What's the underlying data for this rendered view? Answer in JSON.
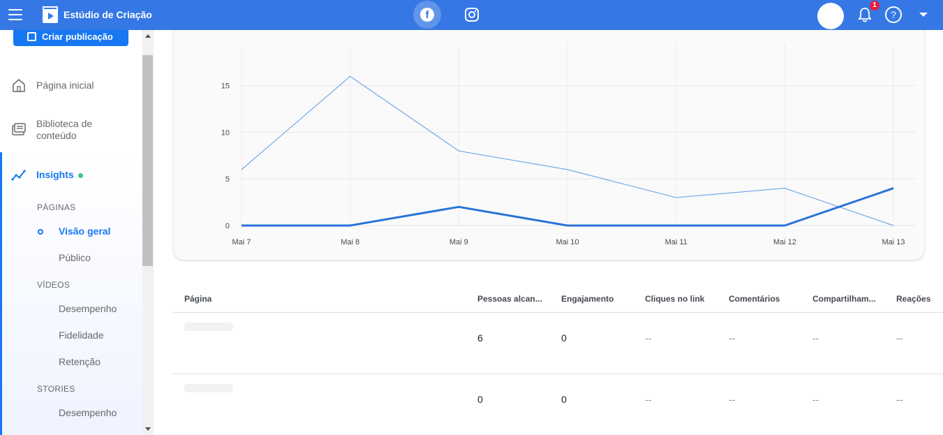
{
  "app": {
    "title": "Estúdio de Criação",
    "notification_count": "1",
    "help_label": "?",
    "facebook_glyph": "f"
  },
  "sidebar": {
    "create_label": "Criar publicação",
    "home_label": "Página inicial",
    "library_label": "Biblioteca de conteúdo",
    "insights_label": "Insights",
    "sections": {
      "pages": "PÁGINAS",
      "videos": "VÍDEOS",
      "stories": "STORIES"
    },
    "pages_items": [
      "Visão geral",
      "Público"
    ],
    "videos_items": [
      "Desempenho",
      "Fidelidade",
      "Retenção"
    ],
    "stories_items": [
      "Desempenho"
    ]
  },
  "chart_data": {
    "type": "line",
    "categories": [
      "Mai 7",
      "Mai 8",
      "Mai 9",
      "Mai 10",
      "Mai 11",
      "Mai 12",
      "Mai 13"
    ],
    "series": [
      {
        "values": [
          6,
          16,
          8,
          6,
          3,
          4,
          0
        ],
        "color": "#6fa8e8",
        "width": 1.2
      },
      {
        "values": [
          0,
          0,
          2,
          0,
          0,
          0,
          4
        ],
        "color": "#2a73d9",
        "width": 3
      }
    ],
    "yticks": [
      "0",
      "5",
      "10",
      "15"
    ],
    "ylim": [
      0,
      17
    ],
    "grid": true
  },
  "table": {
    "headers": [
      "Página",
      "Pessoas alcan...",
      "Engajamento",
      "Cliques no link",
      "Comentários",
      "Compartilham...",
      "Reações"
    ],
    "rows": [
      [
        "6",
        "0",
        "--",
        "--",
        "--",
        "--"
      ],
      [
        "0",
        "0",
        "--",
        "--",
        "--",
        "--"
      ]
    ]
  }
}
